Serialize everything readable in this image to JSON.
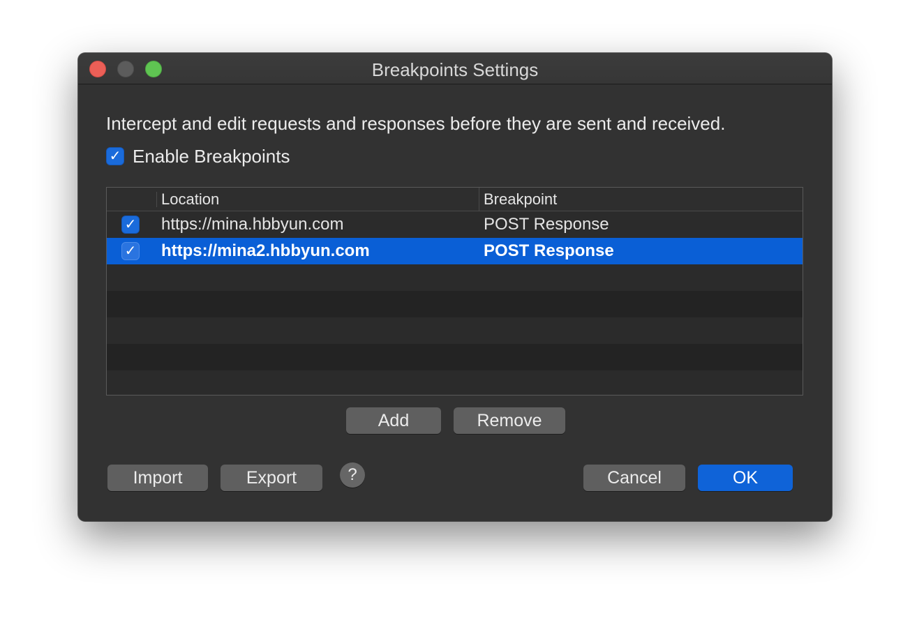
{
  "window": {
    "title": "Breakpoints Settings"
  },
  "description": "Intercept and edit requests and responses before they are sent and received.",
  "enable_breakpoints": {
    "label": "Enable Breakpoints",
    "checked": true,
    "check_glyph": "✓"
  },
  "table": {
    "columns": {
      "location": "Location",
      "breakpoint": "Breakpoint"
    },
    "rows": [
      {
        "checked": true,
        "check_glyph": "✓",
        "location": "https://mina.hbbyun.com",
        "breakpoint": "POST Response",
        "selected": false
      },
      {
        "checked": true,
        "check_glyph": "✓",
        "location": "https://mina2.hbbyun.com",
        "breakpoint": "POST Response",
        "selected": true
      }
    ]
  },
  "buttons": {
    "add": "Add",
    "remove": "Remove",
    "import": "Import",
    "export": "Export",
    "help": "?",
    "cancel": "Cancel",
    "ok": "OK"
  },
  "colors": {
    "window_bg": "#323232",
    "accent": "#0a5fd6",
    "close": "#ec5f57",
    "maximize": "#5fc452"
  },
  "icons": {
    "close": "close-window-icon",
    "minimize": "minimize-window-icon",
    "maximize": "maximize-window-icon",
    "help": "help-icon",
    "checkmark": "checkmark-icon"
  }
}
